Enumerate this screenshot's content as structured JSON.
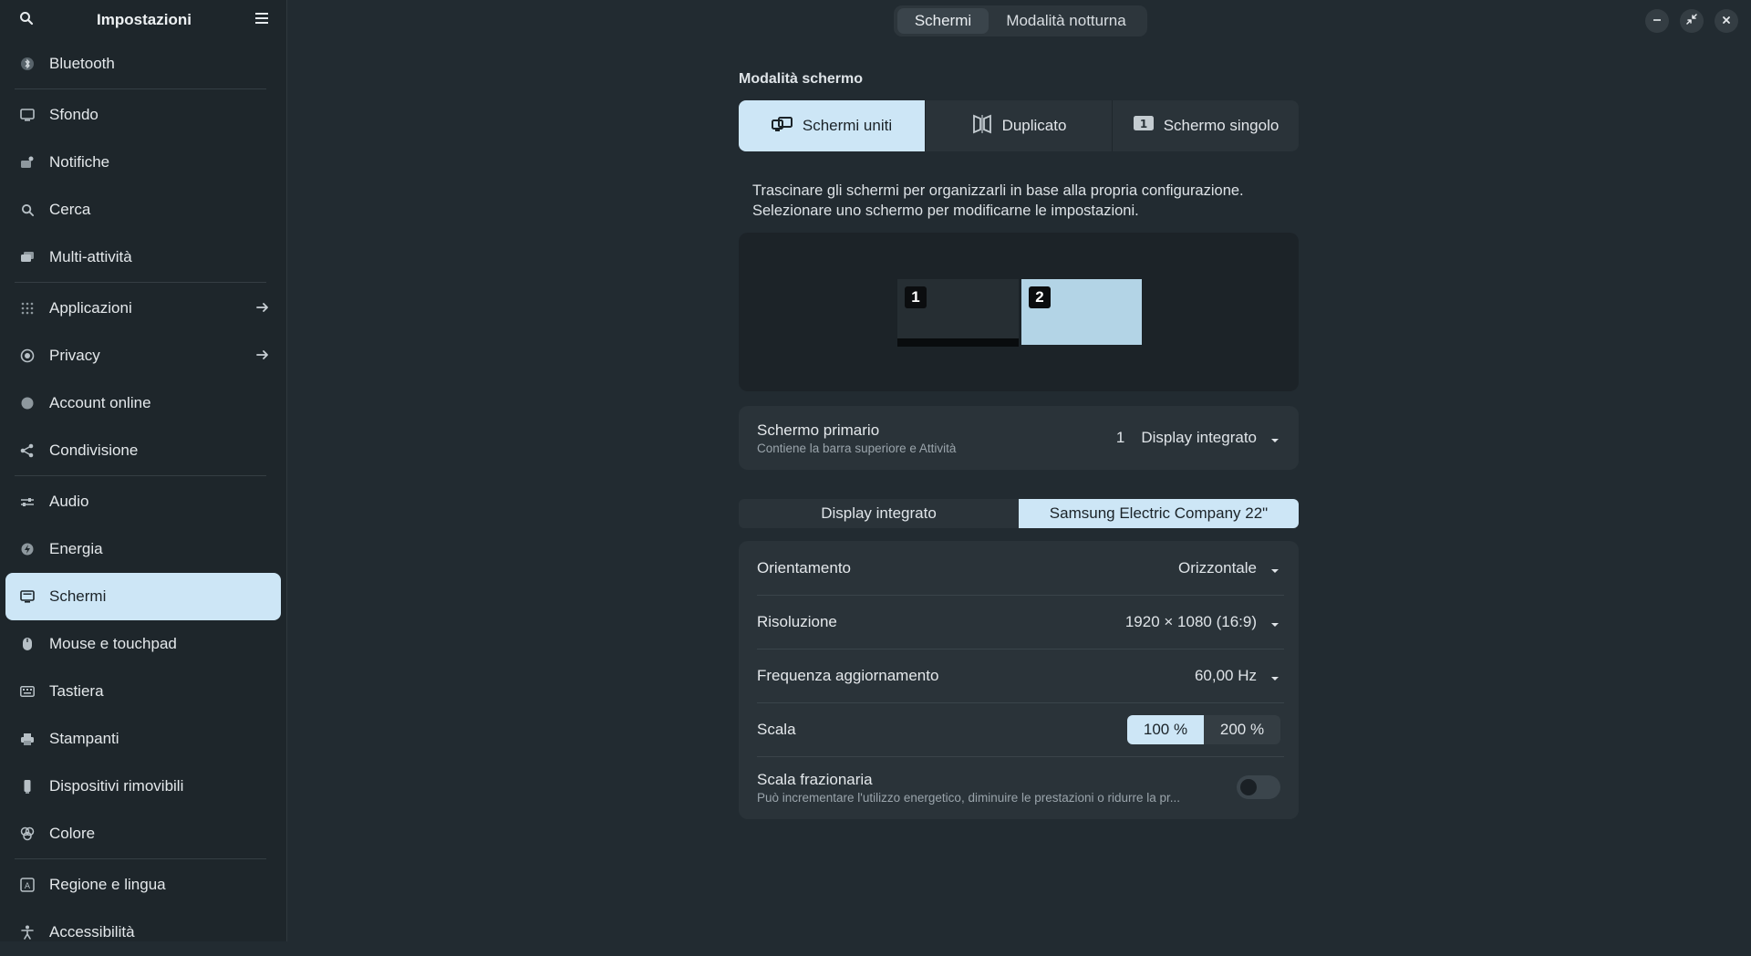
{
  "sidebar": {
    "title": "Impostazioni",
    "items": [
      {
        "label": "Bluetooth",
        "icon": "bluetooth-icon"
      },
      {
        "label": "Sfondo",
        "icon": "wallpaper-icon"
      },
      {
        "label": "Notifiche",
        "icon": "notifications-icon"
      },
      {
        "label": "Cerca",
        "icon": "search-icon"
      },
      {
        "label": "Multi-attività",
        "icon": "multitasking-icon"
      },
      {
        "label": "Applicazioni",
        "icon": "apps-icon"
      },
      {
        "label": "Privacy",
        "icon": "privacy-icon"
      },
      {
        "label": "Account online",
        "icon": "online-accounts-icon"
      },
      {
        "label": "Condivisione",
        "icon": "sharing-icon"
      },
      {
        "label": "Audio",
        "icon": "audio-icon"
      },
      {
        "label": "Energia",
        "icon": "power-icon"
      },
      {
        "label": "Schermi",
        "icon": "display-icon"
      },
      {
        "label": "Mouse e touchpad",
        "icon": "mouse-icon"
      },
      {
        "label": "Tastiera",
        "icon": "keyboard-icon"
      },
      {
        "label": "Stampanti",
        "icon": "printer-icon"
      },
      {
        "label": "Dispositivi rimovibili",
        "icon": "removable-media-icon"
      },
      {
        "label": "Colore",
        "icon": "color-icon"
      },
      {
        "label": "Regione e lingua",
        "icon": "region-icon"
      },
      {
        "label": "Accessibilità",
        "icon": "accessibility-icon"
      }
    ],
    "active": "Schermi"
  },
  "header": {
    "tabs": [
      "Schermi",
      "Modalità notturna"
    ],
    "selected_tab": "Schermi"
  },
  "main": {
    "mode_title": "Modalità schermo",
    "modes": [
      "Schermi uniti",
      "Duplicato",
      "Schermo singolo"
    ],
    "selected_mode": "Schermi uniti",
    "description_line1": "Trascinare gli schermi per organizzarli in base alla propria configurazione.",
    "description_line2": "Selezionare uno schermo per modificarne le impostazioni.",
    "monitors": [
      "1",
      "2"
    ],
    "primary": {
      "label": "Schermo primario",
      "sublabel": "Contiene la barra superiore e Attività",
      "number": "1",
      "value": "Display integrato"
    },
    "display_tabs": [
      "Display integrato",
      "Samsung Electric Company 22\""
    ],
    "selected_display": "Samsung Electric Company 22\"",
    "settings": {
      "orientation_label": "Orientamento",
      "orientation_value": "Orizzontale",
      "resolution_label": "Risoluzione",
      "resolution_value": "1920 × 1080 (16:9)",
      "refresh_label": "Frequenza aggiornamento",
      "refresh_value": "60,00 Hz",
      "scale_label": "Scala",
      "scale_options": [
        "100 %",
        "200 %"
      ],
      "scale_selected": "100 %",
      "fractional_label": "Scala frazionaria",
      "fractional_sublabel": "Può incrementare l'utilizzo energetico, diminuire le prestazioni o ridurre la pr...",
      "fractional_enabled": false
    }
  },
  "colors": {
    "accent": "#cde6f6",
    "background": "#222b31",
    "sidebar": "#1e262b",
    "card": "#2a3339"
  }
}
